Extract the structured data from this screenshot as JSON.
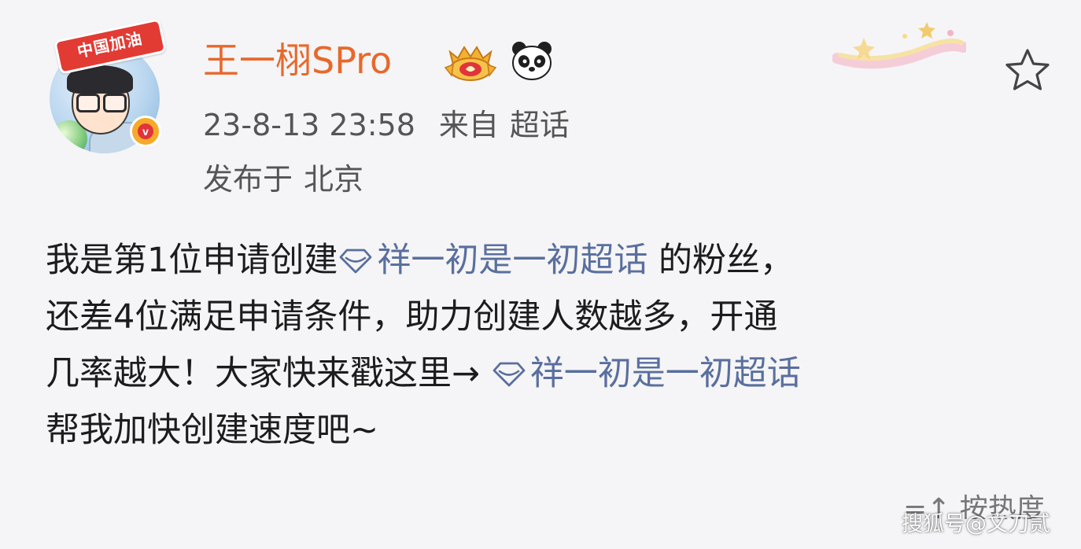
{
  "post": {
    "author": {
      "name": "王一栩SPro",
      "avatar_banner_text": "中国加油",
      "verified_icon": "verified-v-icon",
      "badges": [
        "vip-crown-icon",
        "panda-icon"
      ]
    },
    "meta": {
      "date": "23-8-13 23:58",
      "source_label": "来自",
      "source_name": "超话",
      "location_label": "发布于",
      "location": "北京"
    },
    "favorite_icon": "star-icon",
    "content": {
      "line1_prefix": "我是第1位申请创建",
      "topic_1": "祥一初是一初超话",
      "line1_suffix": " 的粉丝，",
      "line2": "还差4位满足申请条件，助力创建人数越多，开通",
      "line3_prefix": "几率越大！大家快来戳这里→ ",
      "topic_2": "祥一初是一初超话",
      "line4": "帮我加快创建速度吧~"
    },
    "topic_icon": "diamond-icon",
    "sort_label": "按热度",
    "sort_icon": "sort-icon"
  },
  "watermark": "搜狐号@文刀贰",
  "colors": {
    "username": "#e8682b",
    "topic_link": "#5a6f9e",
    "meta_text": "#555555",
    "body_text": "#1c1c1c",
    "background": "#f5f5f7"
  }
}
